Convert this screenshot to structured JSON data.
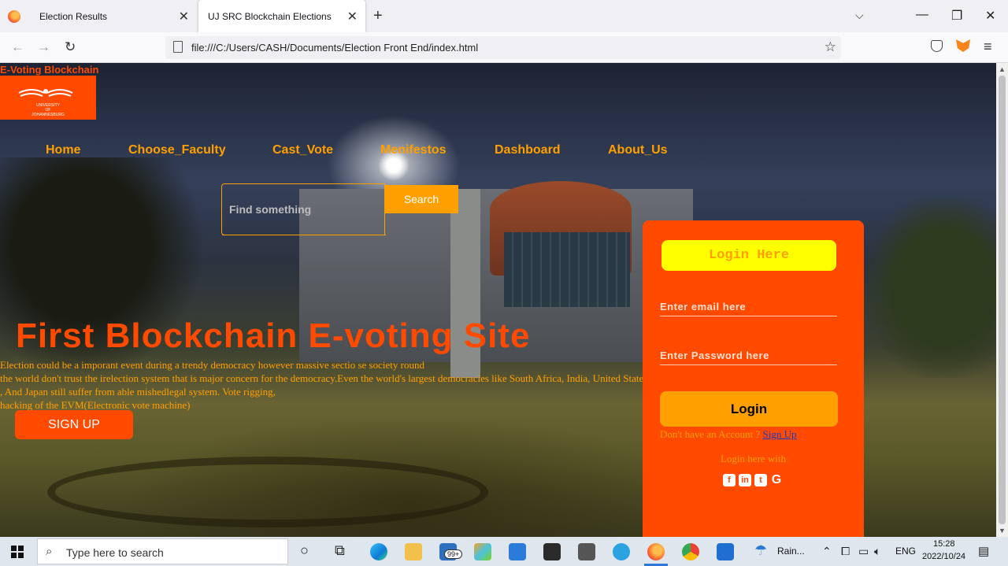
{
  "browser": {
    "tabs": [
      {
        "title": "Election Results",
        "close": "✕"
      },
      {
        "title": "UJ SRC Blockchain Elections",
        "close": "✕"
      }
    ],
    "new_tab": "+",
    "tabs_list": "⌵",
    "window_controls": {
      "minimize": "—",
      "maximize": "❐",
      "close": "✕"
    },
    "back": "←",
    "forward": "→",
    "reload": "↻",
    "url": "file:///C:/Users/CASH/Documents/Election Front End/index.html",
    "bookmark_star": "☆",
    "menu": "≡"
  },
  "site": {
    "brand": "E-Voting Blockchain",
    "logo_lines": [
      "UNIVERSITY",
      "OF",
      "JOHANNESBURG"
    ],
    "nav": [
      "Home",
      "Choose_Faculty",
      "Cast_Vote",
      "Menifestos",
      "Dashboard",
      "About_Us"
    ],
    "search": {
      "placeholder": "Find something",
      "button": "Search"
    },
    "hero": {
      "title": "First Blockchain E-voting Site",
      "lines": [
        "Election could be a imporant event during a trendy democracy however massive sectio se society round",
        "the world don't trust the irelection system that is major concern for the democracy.Even the world's largest democracies like South Africa, India, United States",
        ", And Japan still suffer from able mishedlegal system. Vote rigging,",
        "hacking of the EVM(Electronic vote machine)"
      ],
      "signup_button": "SIGN UP"
    },
    "login": {
      "heading": "Login Here",
      "email_placeholder": "Enter email here",
      "password_placeholder": "Enter Password here",
      "button": "Login",
      "no_account": "Don't have an Account ? ",
      "signup_link": "Sign Up",
      "login_with": "Login here with",
      "socials": [
        "facebook-icon",
        "linkedin-icon",
        "twitter-icon",
        "google-icon"
      ]
    }
  },
  "taskbar": {
    "search_placeholder": "Type here to search",
    "badge": "99+",
    "weather": "Rain...",
    "language": "ENG",
    "time": "15:28",
    "date": "2022/10/24"
  },
  "colors": {
    "accent_orange": "#ff4a00",
    "accent_amber": "#ffa000",
    "login_heading_bg": "#ffff00"
  }
}
